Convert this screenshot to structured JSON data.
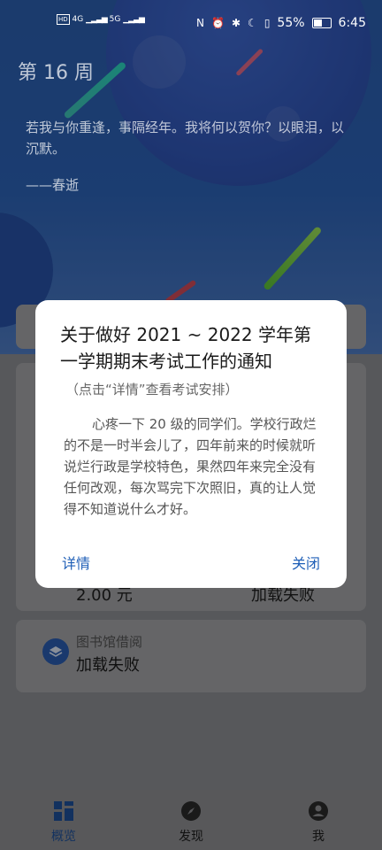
{
  "status_bar": {
    "network_left": "4G",
    "network_right": "5G",
    "battery": "55%",
    "time": "6:45"
  },
  "header": {
    "week": "第 16 周",
    "quote": "若我与你重逢，事隔经年。我将何以贺你？以眼泪，以沉默。",
    "author": "——春逝"
  },
  "cards": {
    "peek_left": "2.00 元",
    "peek_right": "加载失败",
    "library_title": "图书馆借阅",
    "library_status": "加载失败"
  },
  "dialog": {
    "title": "关于做好 2021 ~ 2022 学年第一学期期末考试工作的通知",
    "subtitle": "（点击“详情”查看考试安排）",
    "body": "心疼一下 20 级的同学们。学校行政烂的不是一时半会儿了，四年前来的时候就听说烂行政是学校特色，果然四年来完全没有任何改观，每次骂完下次照旧，真的让人觉得不知道说什么才好。",
    "details_button": "详情",
    "close_button": "关闭"
  },
  "tabbar": {
    "items": [
      {
        "label": "概览",
        "icon": "grid-icon"
      },
      {
        "label": "发现",
        "icon": "compass-icon"
      },
      {
        "label": "我",
        "icon": "person-icon"
      }
    ]
  },
  "colors": {
    "accent": "#1f5fb7",
    "hero_blue": "#2d63b7"
  }
}
